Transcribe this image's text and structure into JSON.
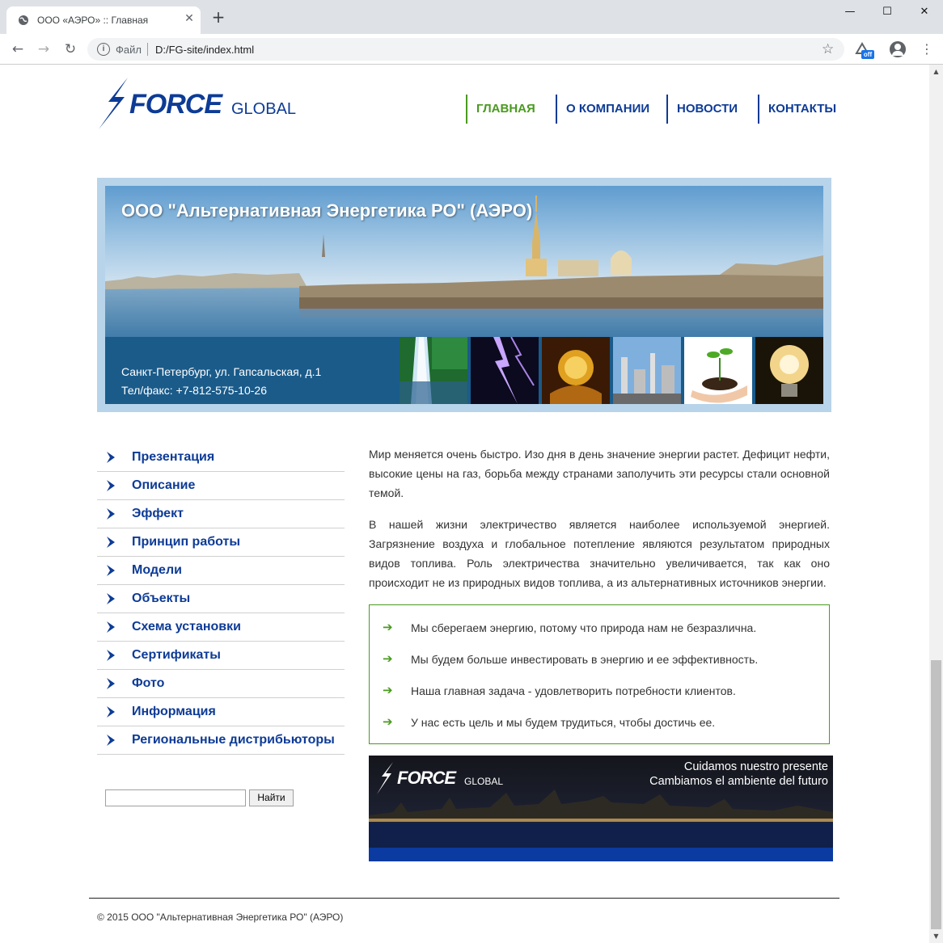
{
  "browser": {
    "tab_title": "ООО «АЭРО» :: Главная",
    "new_tab": "+",
    "scheme_label": "Файл",
    "url": "D:/FG-site/index.html",
    "extension_badge": "off"
  },
  "header": {
    "logo_force": "FORCE",
    "logo_global": "GLOBAL",
    "nav": [
      {
        "label": "ГЛАВНАЯ",
        "active": true
      },
      {
        "label": "О КОМПАНИИ",
        "active": false
      },
      {
        "label": "НОВОСТИ",
        "active": false
      },
      {
        "label": "КОНТАКТЫ",
        "active": false
      }
    ]
  },
  "banner": {
    "title": "ООО \"Альтернативная Энергетика РО\" (АЭРО)",
    "address": "Санкт-Петербург, ул. Гапсальская, д.1",
    "phone": "Тел/факс: +7-812-575-10-26"
  },
  "sidebar": {
    "items": [
      {
        "label": "Презентация"
      },
      {
        "label": "Описание"
      },
      {
        "label": "Эффект"
      },
      {
        "label": "Принцип работы"
      },
      {
        "label": "Модели"
      },
      {
        "label": "Объекты"
      },
      {
        "label": "Схема установки"
      },
      {
        "label": "Сертификаты"
      },
      {
        "label": "Фото"
      },
      {
        "label": "Информация"
      },
      {
        "label": "Региональные дистрибьюторы"
      }
    ],
    "search_value": "",
    "search_button": "Найти"
  },
  "main": {
    "paragraphs": [
      "Мир меняется очень быстро. Изо дня в день значение энергии растет. Дефицит нефти, высокие цены на газ, борьба между странами заполучить эти ресурсы стали основной темой.",
      "В нашей жизни электричество является наиболее используемой энергией. Загрязнение воздуха и глобальное потепление являются результатом природных видов топлива. Роль электричества значительно увеличивается, так как оно происходит не из природных видов топлива, а из альтернативных источников энергии."
    ],
    "goal_arrow": "➔",
    "goals": [
      "Мы сберегаем энергию, потому что природа нам не безразлична.",
      "Мы будем больше инвестировать в энергию и ее эффективность.",
      "Наша главная задача - удовлетворить потребности клиентов.",
      "У нас есть цель и мы будем трудиться, чтобы достичь ее."
    ],
    "promo": {
      "logo_force": "FORCE",
      "logo_global": "GLOBAL",
      "line1": "Cuidamos nuestro presente",
      "line2": "Cambiamos el ambiente del futuro"
    }
  },
  "footer": {
    "copyright": "© 2015 ООО \"Альтернативная Энергетика РО\" (АЭРО)"
  },
  "colors": {
    "brand_blue": "#0d3b96",
    "active_green": "#4a9a1f",
    "banner_strip": "#1a5b8a"
  }
}
